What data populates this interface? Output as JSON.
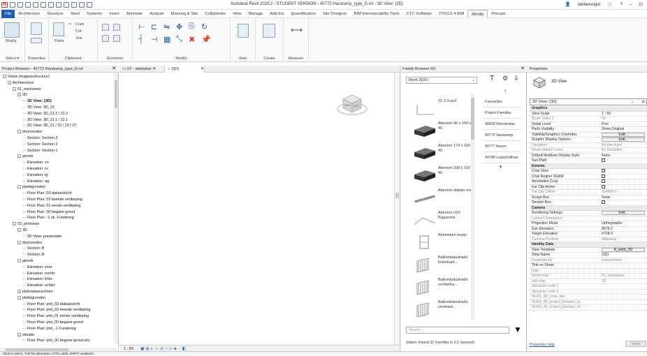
{
  "titlebar": {
    "title": "Autodesk Revit 2020.2 - STUDENT VERSION - 40772 Harskamp_type_D.rvt - 3D View: {3D}",
    "user": "stefanvuijst",
    "help": "?"
  },
  "menu": [
    "File",
    "Architecture",
    "Structure",
    "Steel",
    "Systems",
    "Insert",
    "Annotate",
    "Analyze",
    "Massing & Site",
    "Collaborate",
    "View",
    "Manage",
    "Add-Ins",
    "Quantification",
    "Site Designer",
    "BIM Interoperability Tools",
    "CTC Software",
    "TOOLS 4 BIM",
    "Modify",
    "Precast"
  ],
  "ribbon": {
    "modify": "Modify",
    "paste": "Paste",
    "select": "Select ▾",
    "properties": "Properties",
    "clipboard": "Clipboard",
    "geometry": "Geometry",
    "modify_group": "Modify",
    "view": "View",
    "create": "Create",
    "measure": "Measure",
    "cope": "Cope",
    "cut": "Cut",
    "join": "Join"
  },
  "project_browser": {
    "header": "Project Browser - 40772 Harskamp_type_D.rvt",
    "tree": [
      {
        "t": "Views (mappenstructuur)",
        "l": 0,
        "e": "-"
      },
      {
        "t": "Architectural",
        "l": 1,
        "e": "-"
      },
      {
        "t": "01_werkviews",
        "l": 2,
        "e": "-"
      },
      {
        "t": "3D",
        "l": 3,
        "e": "-"
      },
      {
        "t": "3D View: {3D}",
        "l": 4,
        "b": true
      },
      {
        "t": "3D View: 3D_23",
        "l": 4
      },
      {
        "t": "3D View: 3D_21.2 / 22.2",
        "l": 4
      },
      {
        "t": "3D View: 3D_21.1 / 22.1",
        "l": 4
      },
      {
        "t": "3D View: 3D_21 / 22 / 23 / 27",
        "l": 4
      },
      {
        "t": "doorsnedes",
        "l": 3,
        "e": "-"
      },
      {
        "t": "Section: Section 3",
        "l": 4
      },
      {
        "t": "Section: Section 2",
        "l": 4
      },
      {
        "t": "Section: Section 1",
        "l": 4
      },
      {
        "t": "gevels",
        "l": 3,
        "e": "-"
      },
      {
        "t": "Elevation: vo",
        "l": 4
      },
      {
        "t": "Elevation: ro",
        "l": 4
      },
      {
        "t": "Elevation: lg",
        "l": 4
      },
      {
        "t": "Elevation: ag",
        "l": 4
      },
      {
        "t": "plattegronden",
        "l": 3,
        "e": "-"
      },
      {
        "t": "Floor Plan: 03 dakaanzicht",
        "l": 4
      },
      {
        "t": "Floor Plan: 02 tweede verdieping",
        "l": 4
      },
      {
        "t": "Floor Plan: 01 eerste verdieping",
        "l": 4
      },
      {
        "t": "Floor Plan: 00 begane grond",
        "l": 4
      },
      {
        "t": "Floor Plan: -1 ok. Fundering",
        "l": 4
      },
      {
        "t": "02_plotviews",
        "l": 2,
        "e": "-"
      },
      {
        "t": "3D",
        "l": 3,
        "e": "-"
      },
      {
        "t": "3D View: presentatie",
        "l": 4
      },
      {
        "t": "doorsnedes",
        "l": 3,
        "e": "-"
      },
      {
        "t": "Section: B",
        "l": 4
      },
      {
        "t": "Section: A",
        "l": 4
      },
      {
        "t": "gevels",
        "l": 3,
        "e": "-"
      },
      {
        "t": "Elevation: voor",
        "l": 4
      },
      {
        "t": "Elevation: rechts",
        "l": 4
      },
      {
        "t": "Elevation: links",
        "l": 4
      },
      {
        "t": "Elevation: achter",
        "l": 4
      },
      {
        "t": "plafondaanzichten",
        "l": 3,
        "e": "+"
      },
      {
        "t": "plattegronden",
        "l": 3,
        "e": "-"
      },
      {
        "t": "Floor Plan: plot_03 dakaanzicht",
        "l": 4
      },
      {
        "t": "Floor Plan: plot_02 tweede verdieping",
        "l": 4
      },
      {
        "t": "Floor Plan: plot_01 eerste verdieping",
        "l": 4
      },
      {
        "t": "Floor Plan: plot_00 begane grond",
        "l": 4
      },
      {
        "t": "Floor Plan: plot_-1 Fundering",
        "l": 4
      },
      {
        "t": "situatie",
        "l": 3,
        "e": "-"
      },
      {
        "t": "Floor Plan: plot_00 begane grond situ",
        "l": 4
      }
    ]
  },
  "view_tabs": [
    "01 - startview",
    "{3D}"
  ],
  "viewcube": {
    "face_left": "BACK",
    "face_right": "LEFT"
  },
  "view_status": {
    "scale": "1 : 50"
  },
  "family_browser": {
    "header": "Family Browser R2",
    "version": "Revit 2020",
    "families": [
      {
        "label": "31-2-9.pu3",
        "shape": "cube-small"
      },
      {
        "label": "Aberson 96 x 100 x 49",
        "shape": "block"
      },
      {
        "label": "Aberson 174 x 100 x 49",
        "shape": "block"
      },
      {
        "label": "Aberson 208 x 100 x 49",
        "shape": "block"
      },
      {
        "label": "Aberson daipan met..",
        "shape": "bar"
      },
      {
        "label": "Aberson H10 fluguemat",
        "shape": "line"
      },
      {
        "label": "Aluminium kozijn",
        "shape": "frame"
      },
      {
        "label": "Balkonbalustrade linkerkant...",
        "shape": "rail"
      },
      {
        "label": "Balkonbalustrade rechterka...",
        "shape": "rail"
      },
      {
        "label": "Balkonbalustrade voorkant...",
        "shape": "rail"
      }
    ],
    "side_items": [
      "Favourites",
      "Project Families",
      "40658 Wierdenlan",
      "40772 Harskamp",
      "40777 Assen",
      "40780 Loderhollhuis"
    ],
    "search_placeholder": "Search...",
    "status": "Status: Found 31 Families in 0.2 Seconds."
  },
  "properties": {
    "header": "Properties",
    "type_name": "3D View",
    "selector": "3D View: {3D}",
    "edit_type": "Edit Type",
    "rows": [
      {
        "k": "Graphics",
        "cat": true
      },
      {
        "k": "View Scale",
        "v": "1 : 50"
      },
      {
        "k": "Scale Value 1:",
        "v": "50",
        "dim": true
      },
      {
        "k": "Detail Level",
        "v": "Fine"
      },
      {
        "k": "Parts Visibility",
        "v": "Show Original"
      },
      {
        "k": "Visibility/Graphics Overrides",
        "btn": "Edit..."
      },
      {
        "k": "Graphic Display Options",
        "btn": "Edit..."
      },
      {
        "k": "Discipline",
        "v": "Architectural",
        "dim": true
      },
      {
        "k": "Show Hidden Lines",
        "v": "By Discipline",
        "dim": true
      },
      {
        "k": "Default Analysis Display Style",
        "v": "None"
      },
      {
        "k": "Sun Path",
        "chk": true
      },
      {
        "k": "Extents",
        "cat": true
      },
      {
        "k": "Crop View",
        "chk": true
      },
      {
        "k": "Crop Region Visible",
        "chk": true
      },
      {
        "k": "Annotation Crop",
        "chk": true
      },
      {
        "k": "Far Clip Active",
        "chk": true
      },
      {
        "k": "Far Clip Offset",
        "v": "304800.0",
        "dim": true
      },
      {
        "k": "Scope Box",
        "v": "None"
      },
      {
        "k": "Section Box",
        "chk": true
      },
      {
        "k": "Camera",
        "cat": true
      },
      {
        "k": "Rendering Settings",
        "btn": "Edit..."
      },
      {
        "k": "Locked Orientation",
        "dim": true
      },
      {
        "k": "Projection Mode",
        "v": "Orthographic"
      },
      {
        "k": "Eye Elevation",
        "v": "8679.2"
      },
      {
        "k": "Target Elevation",
        "v": "4728.0"
      },
      {
        "k": "Camera Position",
        "v": "Adjusting",
        "dim": true
      },
      {
        "k": "Identity Data",
        "cat": true
      },
      {
        "k": "View Template",
        "btn": "A_werk_3D"
      },
      {
        "k": "View Name",
        "v": "{3D}"
      },
      {
        "k": "Dependency",
        "v": "Independent",
        "dim": true
      },
      {
        "k": "Title on Sheet"
      },
      {
        "k": "map",
        "dim": true
      },
      {
        "k": "hoofd map",
        "v": "01_werkviews",
        "dim": true
      },
      {
        "k": "sub map",
        "v": "3D",
        "dim": true
      },
      {
        "k": "discipline code 1",
        "dim": true
      },
      {
        "k": "discipline code 2",
        "dim": true
      },
      {
        "k": "NLRS_99_code_bes",
        "dim": true
      },
      {
        "k": "NLRS_99_project_browser_le...",
        "dim": true
      },
      {
        "k": "NLRS_99_project_browser_le...",
        "dim": true
      }
    ],
    "help": "Properties help",
    "apply": "Apply"
  },
  "statusbar": {
    "text": "Click to select, TAB for alternates, CTRL adds, SHIFT unselects."
  },
  "colors": {
    "accent": "#1f5fb3",
    "brick": "#2a2a2a"
  }
}
